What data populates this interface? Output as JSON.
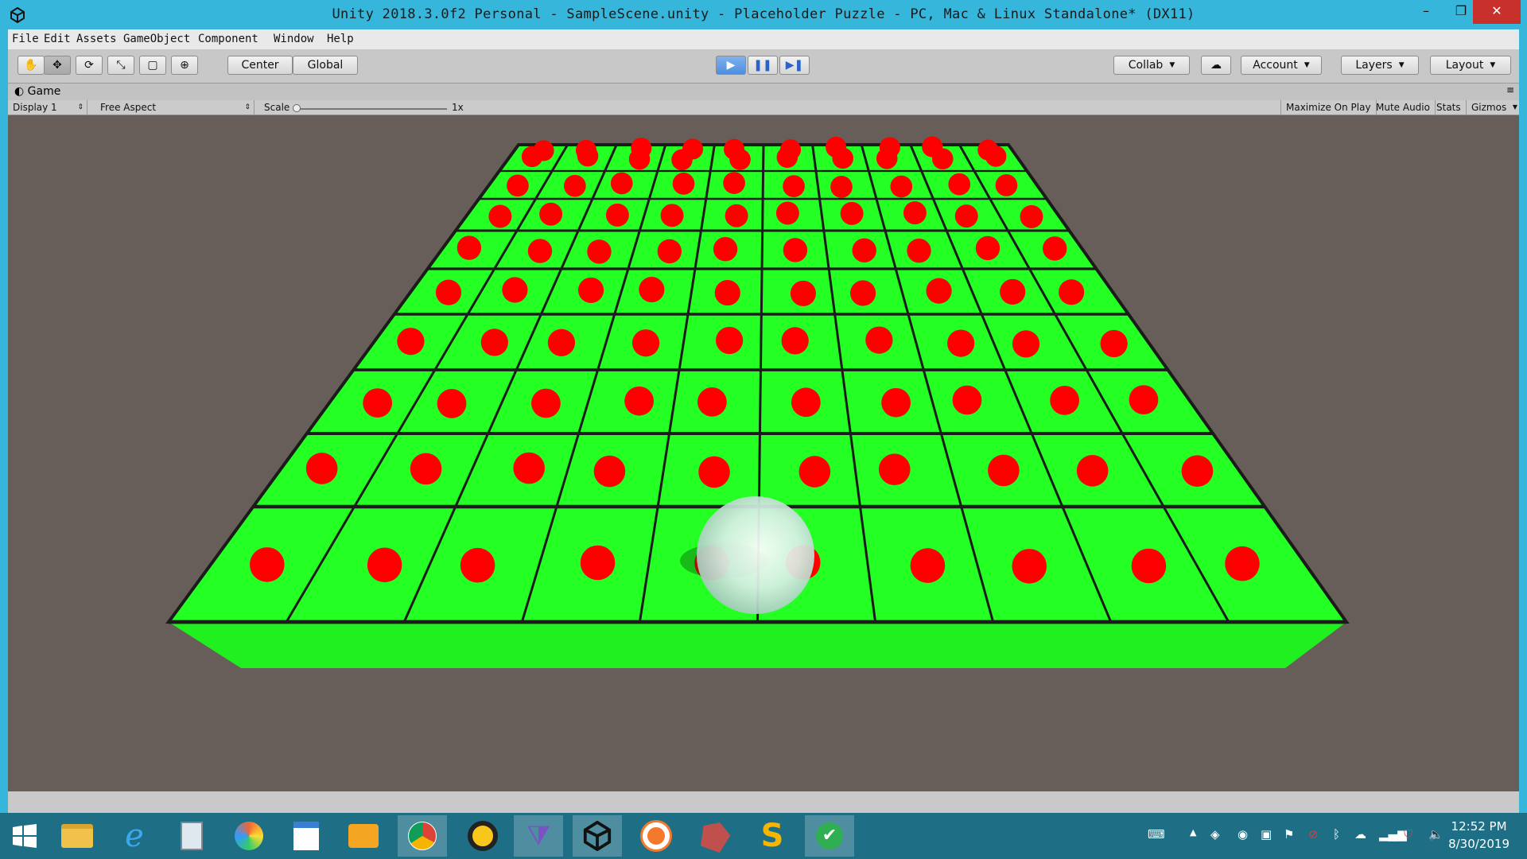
{
  "window": {
    "title": "Unity 2018.3.0f2 Personal - SampleScene.unity - Placeholder Puzzle - PC, Mac & Linux Standalone* (DX11)",
    "minimize": "–",
    "maximize": "❐",
    "close": "✕"
  },
  "menu": [
    "File",
    "Edit",
    "Assets",
    "GameObject",
    "Component",
    "Window",
    "Help"
  ],
  "toolbar": {
    "tools": [
      "hand-icon",
      "move-icon",
      "rotate-icon",
      "scale-icon",
      "rect-icon",
      "transform-icon"
    ],
    "pivot": "Center",
    "space": "Global",
    "collab": "Collab",
    "account": "Account",
    "layers": "Layers",
    "layout": "Layout"
  },
  "game": {
    "tab": "Game",
    "display": "Display 1",
    "aspect": "Free Aspect",
    "scale_label": "Scale",
    "scale_value": "1x",
    "maximize": "Maximize On Play",
    "mute": "Mute Audio",
    "stats": "Stats",
    "gizmos": "Gizmos"
  },
  "scene": {
    "grid_columns": 10,
    "grid_rows": 10,
    "board_color": "#24ff24",
    "dot_color": "#ff0000",
    "background": "#675e59"
  },
  "taskbar": {
    "apps": [
      "windows-start-icon",
      "file-explorer-icon",
      "internet-explorer-icon",
      "calculator-icon",
      "paint-icon",
      "wordpad-icon",
      "mail-icon",
      "chrome-icon",
      "media-icon",
      "visual-studio-icon",
      "unity-icon",
      "blender-icon",
      "app-gem-icon",
      "scratch-icon",
      "teams-icon"
    ],
    "time": "12:52 PM",
    "date": "8/30/2019"
  },
  "colors": {
    "titlebar": "#36b6db",
    "taskbar": "#1e6f86",
    "play": "#4e8ee0"
  }
}
